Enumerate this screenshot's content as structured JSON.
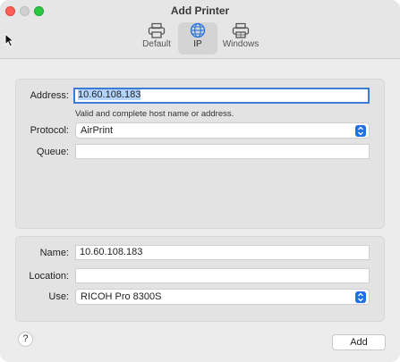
{
  "window": {
    "title": "Add Printer"
  },
  "toolbar": {
    "tabs": [
      {
        "label": "Default",
        "icon": "printer-icon"
      },
      {
        "label": "IP",
        "icon": "globe-icon",
        "selected": true
      },
      {
        "label": "Windows",
        "icon": "windows-printer-icon"
      }
    ]
  },
  "ip_panel": {
    "address_label": "Address:",
    "address_value": "10.60.108.183",
    "address_hint": "Valid and complete host name or address.",
    "protocol_label": "Protocol:",
    "protocol_value": "AirPrint",
    "queue_label": "Queue:",
    "queue_value": ""
  },
  "info_panel": {
    "name_label": "Name:",
    "name_value": "10.60.108.183",
    "location_label": "Location:",
    "location_value": "",
    "use_label": "Use:",
    "use_value": "RICOH Pro 8300S"
  },
  "footer": {
    "help_label": "?",
    "add_label": "Add"
  },
  "colors": {
    "accent": "#1f6fe5",
    "close": "#fe5f57",
    "zoom": "#28c840"
  }
}
